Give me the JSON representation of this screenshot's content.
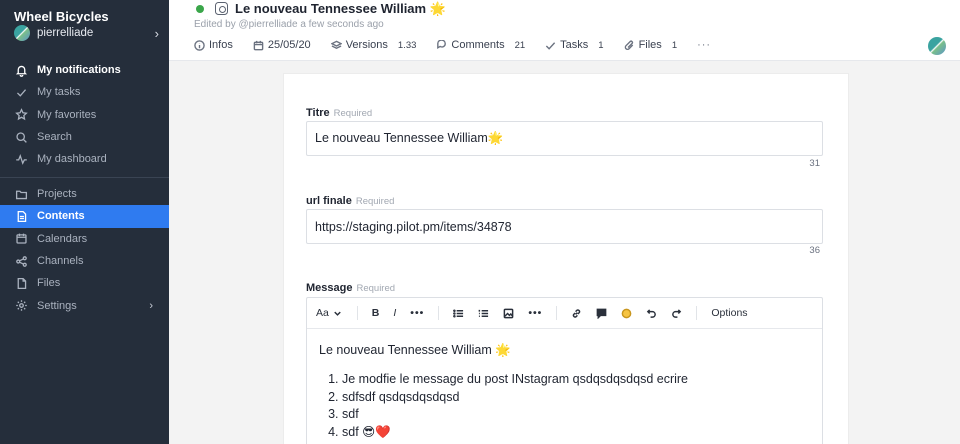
{
  "sidebar": {
    "workspace_name": "Wheel Bicycles",
    "user_name": "pierrelliade",
    "primary_items": [
      {
        "label": "My notifications",
        "icon": "bell-icon"
      },
      {
        "label": "My tasks",
        "icon": "check-icon"
      },
      {
        "label": "My favorites",
        "icon": "star-icon"
      },
      {
        "label": "Search",
        "icon": "search-icon"
      },
      {
        "label": "My dashboard",
        "icon": "activity-icon"
      }
    ],
    "secondary_items": [
      {
        "label": "Projects",
        "icon": "folder-icon"
      },
      {
        "label": "Contents",
        "icon": "document-icon",
        "active": true
      },
      {
        "label": "Calendars",
        "icon": "calendar-icon"
      },
      {
        "label": "Channels",
        "icon": "share-icon"
      },
      {
        "label": "Files",
        "icon": "file-icon"
      },
      {
        "label": "Settings",
        "icon": "gear-icon"
      }
    ]
  },
  "header": {
    "title": "Le nouveau Tennessee William 🌟",
    "edited_by": "Edited by @pierrelliade a few seconds ago",
    "toolbar": {
      "infos": "Infos",
      "date": "25/05/20",
      "versions": "Versions",
      "versions_count": "1.33",
      "comments": "Comments",
      "comments_count": "21",
      "tasks": "Tasks",
      "tasks_count": "1",
      "files": "Files",
      "files_count": "1",
      "more": "···"
    }
  },
  "form": {
    "titre": {
      "label": "Titre",
      "required": "Required",
      "value": "Le nouveau Tennessee William🌟",
      "counter": "31"
    },
    "url": {
      "label": "url finale",
      "required": "Required",
      "value": "https://staging.pilot.pm/items/34878",
      "counter": "36"
    },
    "message": {
      "label": "Message",
      "required": "Required",
      "toolbar": {
        "font_size": "Aa",
        "options": "Options"
      },
      "intro": "Le nouveau Tennessee William 🌟",
      "items": [
        "Je modfie le message du post INstagram qsdqsdqsdqsd ecrire",
        "sdfsdf qsdqsdqsdqsd",
        "sdf",
        "sdf 😎❤️"
      ]
    }
  },
  "colors": {
    "sidebar_bg": "#252e3b",
    "active_bg": "#2f7bf0",
    "status_green": "#3aa64a"
  }
}
